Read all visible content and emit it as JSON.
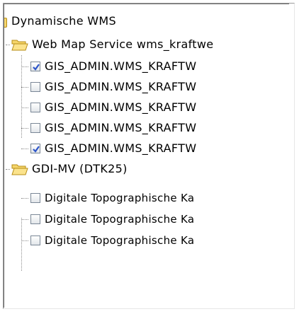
{
  "tree": {
    "root": {
      "label": "Dynamische WMS",
      "icon": "folder-open-icon"
    },
    "groups": [
      {
        "label": "Web Map Service wms_kraftwe",
        "icon": "folder-open-icon",
        "layers": [
          {
            "label": "GIS_ADMIN.WMS_KRAFTW",
            "checked": true
          },
          {
            "label": "GIS_ADMIN.WMS_KRAFTW",
            "checked": false
          },
          {
            "label": "GIS_ADMIN.WMS_KRAFTW",
            "checked": false
          },
          {
            "label": "GIS_ADMIN.WMS_KRAFTW",
            "checked": false
          },
          {
            "label": "GIS_ADMIN.WMS_KRAFTW",
            "checked": true
          }
        ]
      },
      {
        "label": "GDI-MV (DTK25)",
        "icon": "folder-open-icon",
        "layers": [
          {
            "label": "Digitale Topographische Ka",
            "checked": false
          },
          {
            "label": "Digitale Topographische Ka",
            "checked": false
          },
          {
            "label": "Digitale Topographische Ka",
            "checked": false
          }
        ]
      }
    ]
  },
  "colors": {
    "folder_fill": "#f5d56b",
    "folder_stroke": "#b78d16",
    "checkmark": "#2d55c9"
  }
}
